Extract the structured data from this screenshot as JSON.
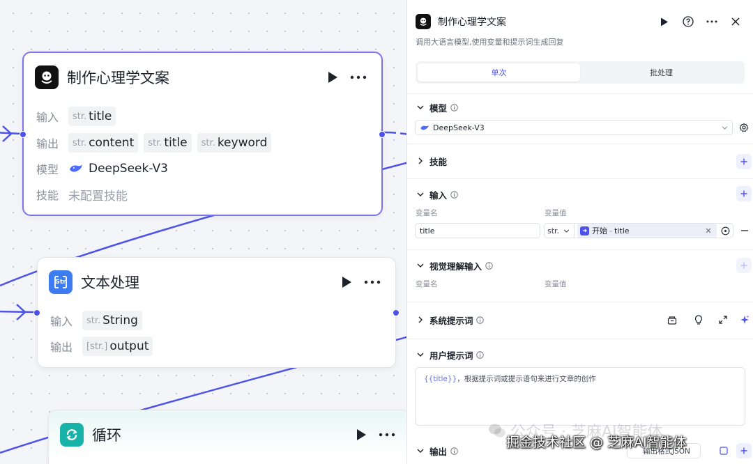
{
  "canvas": {
    "node_llm": {
      "title": "制作心理学文案",
      "input_label": "输入",
      "output_label": "输出",
      "model_label": "模型",
      "skill_label": "技能",
      "input_vars": [
        {
          "type": "str.",
          "name": "title"
        }
      ],
      "output_vars": [
        {
          "type": "str.",
          "name": "content"
        },
        {
          "type": "str.",
          "name": "title"
        },
        {
          "type": "str.",
          "name": "keyword"
        }
      ],
      "model": "DeepSeek-V3",
      "skills": "未配置技能"
    },
    "node_text": {
      "title": "文本处理",
      "icon_text": "Str",
      "input_label": "输入",
      "output_label": "输出",
      "input_var": {
        "type": "str.",
        "name": "String"
      },
      "output_var": {
        "type": "[str.]",
        "name": "output"
      }
    },
    "node_loop": {
      "title": "循环"
    }
  },
  "panel": {
    "title": "制作心理学文案",
    "description": "调用大语言模型,使用变量和提示词生成回复",
    "tabs": [
      {
        "label": "单次",
        "active": true
      },
      {
        "label": "批处理",
        "active": false
      }
    ],
    "model_section": {
      "label": "模型",
      "value": "DeepSeek-V3"
    },
    "skills_section": {
      "label": "技能"
    },
    "input_section": {
      "label": "输入",
      "col_name": "变量名",
      "col_value": "变量值",
      "row": {
        "name": "title",
        "type": "str.",
        "ref_node": "开始",
        "ref_sep": "-",
        "ref_var": "title"
      }
    },
    "vision_section": {
      "label": "视觉理解输入",
      "col_name": "变量名",
      "col_value": "变量值"
    },
    "system_prompt_section": {
      "label": "系统提示词"
    },
    "user_prompt_section": {
      "label": "用户提示词",
      "var_text": "{{title}}",
      "prompt_text": "，根据提示词或提示语句来进行文章的创作"
    },
    "output_section": {
      "label": "输出",
      "format_button": "输出格式JSON"
    }
  },
  "watermark": {
    "line1": "公众号 · 芝麻AI智能体",
    "line2": "掘金技术社区 @ 芝麻AI智能体"
  },
  "colors": {
    "accent": "#4d53e8",
    "edge": "#4d53e8",
    "selected_border": "#7b74e6",
    "text_node_icon": "#3d7cf0",
    "loop_node_icon": "#17b3a8"
  }
}
